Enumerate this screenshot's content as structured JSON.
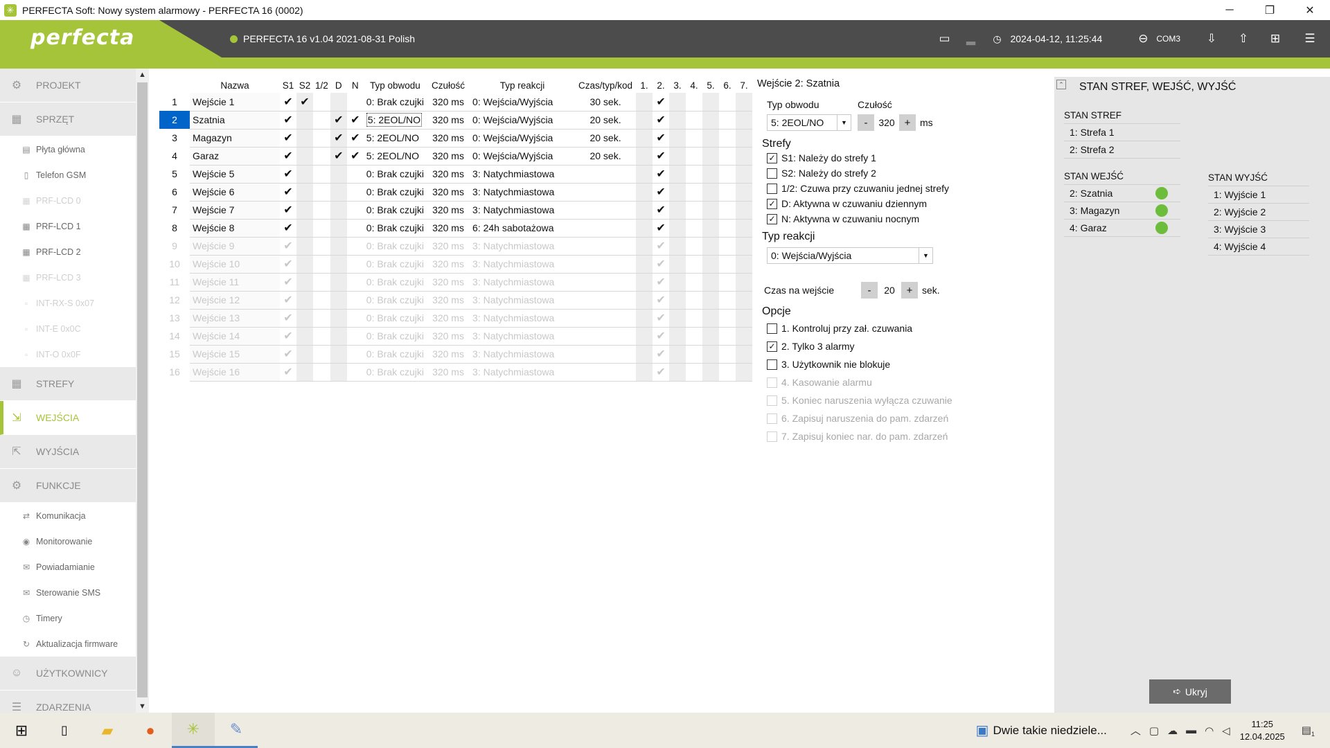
{
  "window": {
    "title": "PERFECTA Soft: Nowy system alarmowy - PERFECTA 16  (0002)"
  },
  "header": {
    "logo": "perfecta",
    "device": "PERFECTA 16 v1.04 2021-08-31 Polish",
    "datetime": "2024-04-12, 11:25:44",
    "port": "COM3"
  },
  "sidebar": {
    "items": [
      {
        "label": "PROJEKT",
        "type": "main",
        "icon": "gear-icon"
      },
      {
        "label": "SPRZĘT",
        "type": "main",
        "icon": "chip-icon"
      },
      {
        "label": "Płyta główna",
        "type": "sub",
        "icon": "board-icon"
      },
      {
        "label": "Telefon GSM",
        "type": "sub",
        "icon": "phone-icon"
      },
      {
        "label": "PRF-LCD 0",
        "type": "sub",
        "disabled": true,
        "icon": "keypad-icon"
      },
      {
        "label": "PRF-LCD 1",
        "type": "sub",
        "icon": "keypad-icon"
      },
      {
        "label": "PRF-LCD 2",
        "type": "sub",
        "icon": "keypad-icon"
      },
      {
        "label": "PRF-LCD 3",
        "type": "sub",
        "disabled": true,
        "icon": "keypad-icon"
      },
      {
        "label": "INT-RX-S 0x07",
        "type": "sub",
        "disabled": true,
        "icon": "module-icon"
      },
      {
        "label": "INT-E 0x0C",
        "type": "sub",
        "disabled": true,
        "icon": "module-icon"
      },
      {
        "label": "INT-O 0x0F",
        "type": "sub",
        "disabled": true,
        "icon": "module-icon"
      },
      {
        "label": "STREFY",
        "type": "main",
        "icon": "grid-icon"
      },
      {
        "label": "WEJŚCIA",
        "type": "main",
        "active": true,
        "icon": "input-icon"
      },
      {
        "label": "WYJŚCIA",
        "type": "main",
        "icon": "output-icon"
      },
      {
        "label": "FUNKCJE",
        "type": "main",
        "icon": "cog-icon"
      },
      {
        "label": "Komunikacja",
        "type": "sub",
        "icon": "comm-icon"
      },
      {
        "label": "Monitorowanie",
        "type": "sub",
        "icon": "eye-icon"
      },
      {
        "label": "Powiadamianie",
        "type": "sub",
        "icon": "notify-icon"
      },
      {
        "label": "Sterowanie SMS",
        "type": "sub",
        "icon": "sms-icon"
      },
      {
        "label": "Timery",
        "type": "sub",
        "icon": "timer-icon"
      },
      {
        "label": "Aktualizacja firmware",
        "type": "sub",
        "icon": "update-icon"
      },
      {
        "label": "UŻYTKOWNICY",
        "type": "main",
        "icon": "user-icon"
      },
      {
        "label": "ZDARZENIA",
        "type": "main",
        "icon": "list-icon"
      }
    ]
  },
  "grid": {
    "columns": [
      "Nazwa",
      "S1",
      "S2",
      "1/2",
      "D",
      "N",
      "Typ obwodu",
      "Czułość",
      "Typ reakcji",
      "Czas/typ/kod",
      "1.",
      "2.",
      "3.",
      "4.",
      "5.",
      "6.",
      "7."
    ],
    "rows": [
      {
        "no": "1",
        "name": "Wejście  1",
        "s1": "✔",
        "s2": "✔",
        "half": "",
        "d": "",
        "n": "",
        "type": "0: Brak czujki",
        "sens": "320 ms",
        "reaction": "0: Wejścia/Wyjścia",
        "time": "30 sek.",
        "c2": "✔",
        "state": "normal"
      },
      {
        "no": "2",
        "name": "Szatnia",
        "s1": "✔",
        "s2": "",
        "half": "",
        "d": "✔",
        "n": "✔",
        "type": "5: 2EOL/NO",
        "sens": "320 ms",
        "reaction": "0: Wejścia/Wyjścia",
        "time": "20 sek.",
        "c2": "✔",
        "state": "selected"
      },
      {
        "no": "3",
        "name": "Magazyn",
        "s1": "✔",
        "s2": "",
        "half": "",
        "d": "✔",
        "n": "✔",
        "type": "5: 2EOL/NO",
        "sens": "320 ms",
        "reaction": "0: Wejścia/Wyjścia",
        "time": "20 sek.",
        "c2": "✔",
        "state": "normal"
      },
      {
        "no": "4",
        "name": "Garaz",
        "s1": "✔",
        "s2": "",
        "half": "",
        "d": "✔",
        "n": "✔",
        "type": "5: 2EOL/NO",
        "sens": "320 ms",
        "reaction": "0: Wejścia/Wyjścia",
        "time": "20 sek.",
        "c2": "✔",
        "state": "normal"
      },
      {
        "no": "5",
        "name": "Wejście  5",
        "s1": "✔",
        "s2": "",
        "half": "",
        "d": "",
        "n": "",
        "type": "0: Brak czujki",
        "sens": "320 ms",
        "reaction": "3: Natychmiastowa",
        "time": "",
        "c2": "✔",
        "state": "normal"
      },
      {
        "no": "6",
        "name": "Wejście  6",
        "s1": "✔",
        "s2": "",
        "half": "",
        "d": "",
        "n": "",
        "type": "0: Brak czujki",
        "sens": "320 ms",
        "reaction": "3: Natychmiastowa",
        "time": "",
        "c2": "✔",
        "state": "normal"
      },
      {
        "no": "7",
        "name": "Wejście  7",
        "s1": "✔",
        "s2": "",
        "half": "",
        "d": "",
        "n": "",
        "type": "0: Brak czujki",
        "sens": "320 ms",
        "reaction": "3: Natychmiastowa",
        "time": "",
        "c2": "✔",
        "state": "normal"
      },
      {
        "no": "8",
        "name": "Wejście  8",
        "s1": "✔",
        "s2": "",
        "half": "",
        "d": "",
        "n": "",
        "type": "0: Brak czujki",
        "sens": "320 ms",
        "reaction": "6: 24h sabotażowa",
        "time": "",
        "c2": "✔",
        "state": "normal"
      },
      {
        "no": "9",
        "name": "Wejście  9",
        "s1": "✔",
        "s2": "",
        "half": "",
        "d": "",
        "n": "",
        "type": "0: Brak czujki",
        "sens": "320 ms",
        "reaction": "3: Natychmiastowa",
        "time": "",
        "c2": "✔",
        "state": "disabled"
      },
      {
        "no": "10",
        "name": "Wejście 10",
        "s1": "✔",
        "s2": "",
        "half": "",
        "d": "",
        "n": "",
        "type": "0: Brak czujki",
        "sens": "320 ms",
        "reaction": "3: Natychmiastowa",
        "time": "",
        "c2": "✔",
        "state": "disabled"
      },
      {
        "no": "11",
        "name": "Wejście 11",
        "s1": "✔",
        "s2": "",
        "half": "",
        "d": "",
        "n": "",
        "type": "0: Brak czujki",
        "sens": "320 ms",
        "reaction": "3: Natychmiastowa",
        "time": "",
        "c2": "✔",
        "state": "disabled"
      },
      {
        "no": "12",
        "name": "Wejście 12",
        "s1": "✔",
        "s2": "",
        "half": "",
        "d": "",
        "n": "",
        "type": "0: Brak czujki",
        "sens": "320 ms",
        "reaction": "3: Natychmiastowa",
        "time": "",
        "c2": "✔",
        "state": "disabled"
      },
      {
        "no": "13",
        "name": "Wejście 13",
        "s1": "✔",
        "s2": "",
        "half": "",
        "d": "",
        "n": "",
        "type": "0: Brak czujki",
        "sens": "320 ms",
        "reaction": "3: Natychmiastowa",
        "time": "",
        "c2": "✔",
        "state": "disabled"
      },
      {
        "no": "14",
        "name": "Wejście 14",
        "s1": "✔",
        "s2": "",
        "half": "",
        "d": "",
        "n": "",
        "type": "0: Brak czujki",
        "sens": "320 ms",
        "reaction": "3: Natychmiastowa",
        "time": "",
        "c2": "✔",
        "state": "disabled"
      },
      {
        "no": "15",
        "name": "Wejście 15",
        "s1": "✔",
        "s2": "",
        "half": "",
        "d": "",
        "n": "",
        "type": "0: Brak czujki",
        "sens": "320 ms",
        "reaction": "3: Natychmiastowa",
        "time": "",
        "c2": "✔",
        "state": "disabled"
      },
      {
        "no": "16",
        "name": "Wejście 16",
        "s1": "✔",
        "s2": "",
        "half": "",
        "d": "",
        "n": "",
        "type": "0: Brak czujki",
        "sens": "320 ms",
        "reaction": "3: Natychmiastowa",
        "time": "",
        "c2": "✔",
        "state": "disabled"
      }
    ]
  },
  "detail": {
    "title_prefix": "Wejście 2:",
    "title_name": "Szatnia",
    "circuit_label": "Typ obwodu",
    "circuit_value": "5: 2EOL/NO",
    "sens_label": "Czułość",
    "sens_value": "320",
    "sens_unit": "ms",
    "minus": "-",
    "plus": "+",
    "zones_title": "Strefy",
    "zones": [
      {
        "label": "S1: Należy do strefy 1",
        "checked": true
      },
      {
        "label": "S2: Należy do strefy 2",
        "checked": false
      },
      {
        "label": "1/2: Czuwa przy czuwaniu jednej strefy",
        "checked": false
      },
      {
        "label": "D: Aktywna w czuwaniu dziennym",
        "checked": true
      },
      {
        "label": "N: Aktywna w czuwaniu nocnym",
        "checked": true
      }
    ],
    "reaction_title": "Typ reakcji",
    "reaction_value": "0: Wejścia/Wyjścia",
    "entry_label": "Czas na wejście",
    "entry_value": "20",
    "entry_unit": "sek.",
    "options_title": "Opcje",
    "options": [
      {
        "label": "1. Kontroluj przy zał. czuwania",
        "checked": false,
        "disabled": false
      },
      {
        "label": "2. Tylko 3 alarmy",
        "checked": true,
        "disabled": false
      },
      {
        "label": "3. Użytkownik nie blokuje",
        "checked": false,
        "disabled": false
      },
      {
        "label": "4. Kasowanie alarmu",
        "checked": false,
        "disabled": true
      },
      {
        "label": "5. Koniec naruszenia wyłącza czuwanie",
        "checked": false,
        "disabled": true
      },
      {
        "label": "6. Zapisuj naruszenia do pam. zdarzeń",
        "checked": false,
        "disabled": true
      },
      {
        "label": "7. Zapisuj koniec nar. do pam. zdarzeń",
        "checked": false,
        "disabled": true
      }
    ]
  },
  "status": {
    "title": "STAN STREF, WEJŚĆ, WYJŚĆ",
    "zones_head": "STAN STREF",
    "zones": [
      "1: Strefa 1",
      "2: Strefa 2"
    ],
    "inputs_head": "STAN WEJŚĆ",
    "inputs": [
      "2: Szatnia",
      "3: Magazyn",
      "4: Garaz"
    ],
    "outputs_head": "STAN WYJŚĆ",
    "outputs": [
      "1: Wyjście  1",
      "2: Wyjście  2",
      "3: Wyjście  3",
      "4: Wyjście  4"
    ],
    "hide_button": "Ukryj",
    "ok_color": "#6dbd3c"
  },
  "taskbar": {
    "notification": "Dwie takie niedziele...",
    "time": "11:25",
    "date": "12.04.2025",
    "badge": "1"
  },
  "colors": {
    "brand": "#a6c43a",
    "header": "#4c4c4c",
    "selected": "#0064c8"
  }
}
